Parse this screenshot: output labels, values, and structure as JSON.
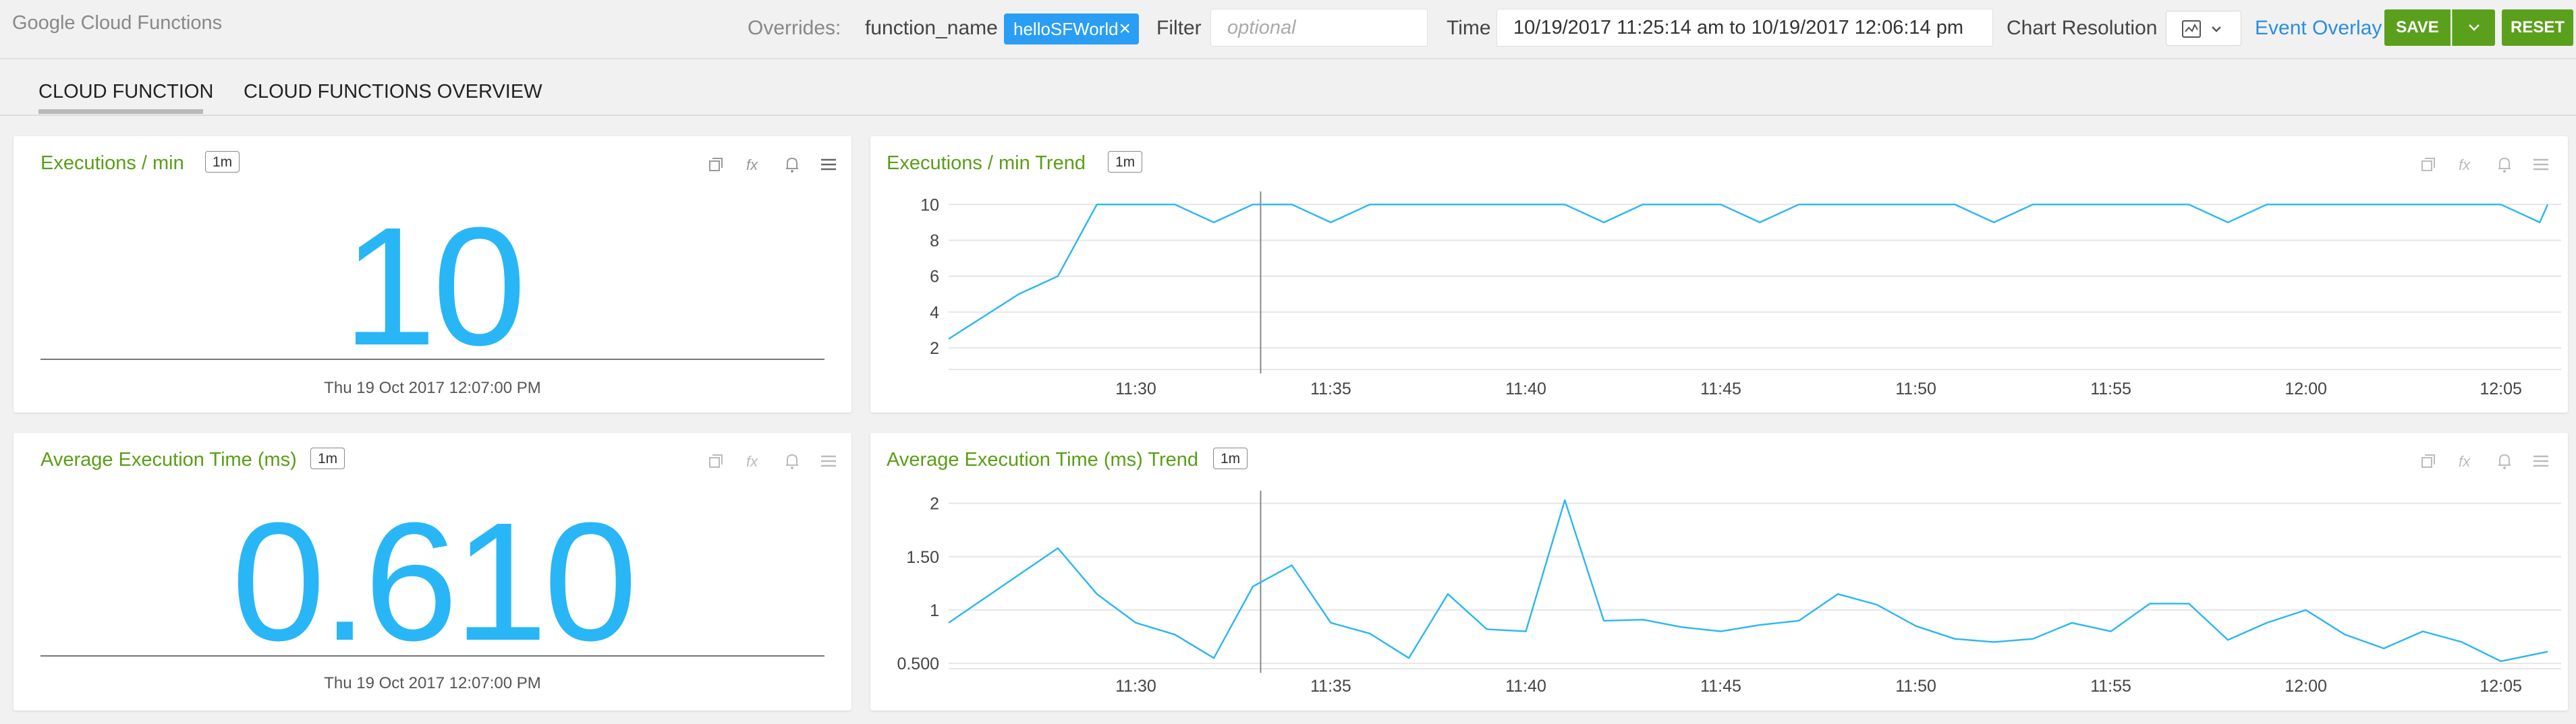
{
  "app": {
    "title": "Google Cloud Functions"
  },
  "toolbar": {
    "overrides_label": "Overrides:",
    "filter_key": "function_name",
    "filter_value": "helloSFWorld",
    "filter_label": "Filter",
    "filter_placeholder": "optional",
    "time_label": "Time",
    "time_range": "10/19/2017 11:25:14 am to 10/19/2017 12:06:14 pm",
    "chart_resolution_label": "Chart Resolution",
    "event_overlay_label": "Event Overlay",
    "save_label": "SAVE",
    "reset_label": "RESET"
  },
  "tabs": [
    {
      "label": "CLOUD FUNCTION",
      "active": true
    },
    {
      "label": "CLOUD FUNCTIONS OVERVIEW",
      "active": false
    }
  ],
  "panels": {
    "exec_value": {
      "title": "Executions / min",
      "resolution": "1m",
      "value": "10",
      "timestamp": "Thu 19 Oct 2017 12:07:00 PM"
    },
    "exec_trend": {
      "title": "Executions / min Trend",
      "resolution": "1m"
    },
    "avg_value": {
      "title": "Average Execution Time (ms)",
      "resolution": "1m",
      "value": "0.610",
      "timestamp": "Thu 19 Oct 2017 12:07:00 PM"
    },
    "avg_trend": {
      "title": "Average Execution Time (ms) Trend",
      "resolution": "1m"
    }
  },
  "icons": [
    "copy-icon",
    "fx-icon",
    "bell-icon",
    "menu-icon"
  ],
  "colors": {
    "accent": "#29b6f6",
    "title_green": "#5a9e16",
    "button_green": "#5ba01c",
    "chip_blue": "#2a9df4",
    "link_blue": "#2a8de0"
  },
  "chart_data": [
    {
      "type": "line",
      "x_unit": "minutes past 11:00",
      "xlim": [
        25.2,
        36.6
      ],
      "ylim": [
        0.8,
        10.5
      ],
      "x_ticks": [
        30,
        35,
        40,
        45,
        50,
        55,
        60,
        65
      ],
      "x_tick_labels": [
        "11:30",
        "11:35",
        "11:40",
        "11:45",
        "11:50",
        "11:55",
        "12:00",
        "12:05"
      ],
      "y_ticks": [
        2,
        4,
        6,
        8,
        10
      ],
      "y_tick_labels": [
        "2",
        "4",
        "6",
        "8",
        "10"
      ],
      "marker_x": 33.2,
      "color": "#29b6f6",
      "x": [
        25.2,
        27,
        28,
        29,
        30,
        31,
        32,
        33,
        34,
        35,
        36,
        37,
        38,
        39,
        40,
        41,
        42,
        43,
        44,
        45,
        46,
        47,
        48,
        49,
        50,
        51,
        52,
        53,
        54,
        55,
        56,
        57,
        58,
        59,
        60,
        61,
        62,
        63,
        64,
        65,
        66,
        66.2
      ],
      "y": [
        2.5,
        5,
        6,
        10,
        10,
        10,
        9,
        10,
        10,
        9,
        10,
        10,
        10,
        10,
        10,
        10,
        9,
        10,
        10,
        10,
        9,
        10,
        10,
        10,
        10,
        10,
        9,
        10,
        10,
        10,
        10,
        10,
        9,
        10,
        10,
        10,
        10,
        10,
        10,
        10,
        9,
        10
      ]
    },
    {
      "type": "line",
      "x_unit": "minutes past 11:00",
      "xlim": [
        25.2,
        36.6
      ],
      "ylim": [
        0.45,
        2.08
      ],
      "x_ticks": [
        30,
        35,
        40,
        45,
        50,
        55,
        60,
        65
      ],
      "x_tick_labels": [
        "11:30",
        "11:35",
        "11:40",
        "11:45",
        "11:50",
        "11:55",
        "12:00",
        "12:05"
      ],
      "y_ticks": [
        0.5,
        1,
        1.5,
        2
      ],
      "y_tick_labels": [
        "0.500",
        "1",
        "1.50",
        "2"
      ],
      "marker_x": 33.2,
      "color": "#29b6f6",
      "x": [
        25.2,
        28,
        29,
        30,
        31,
        32,
        33,
        34,
        35,
        36,
        37,
        38,
        39,
        40,
        41,
        42,
        43,
        44,
        45,
        46,
        47,
        48,
        49,
        50,
        51,
        52,
        53,
        54,
        55,
        56,
        57,
        58,
        59,
        60,
        61,
        62,
        63,
        64,
        65,
        66.2
      ],
      "y": [
        0.88,
        1.58,
        1.15,
        0.88,
        0.77,
        0.55,
        1.22,
        1.42,
        0.88,
        0.78,
        0.55,
        1.15,
        0.82,
        0.8,
        2.03,
        0.9,
        0.91,
        0.84,
        0.8,
        0.86,
        0.9,
        1.15,
        1.05,
        0.85,
        0.73,
        0.7,
        0.73,
        0.88,
        0.8,
        1.06,
        1.06,
        0.72,
        0.88,
        1.0,
        0.77,
        0.64,
        0.8,
        0.7,
        0.52,
        0.61
      ]
    }
  ]
}
